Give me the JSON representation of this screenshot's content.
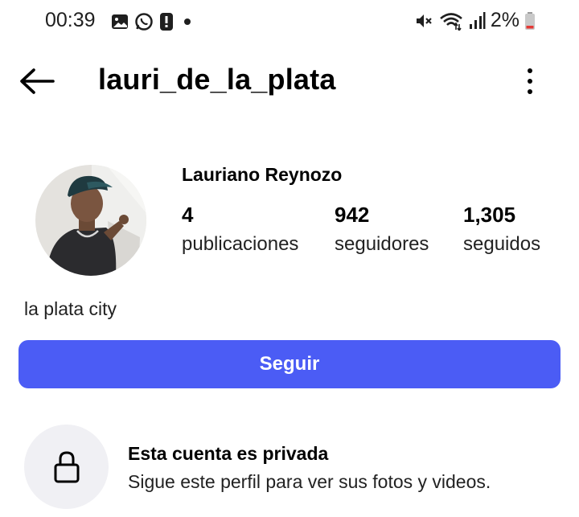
{
  "status_bar": {
    "time": "00:39",
    "battery_percent": "2%"
  },
  "header": {
    "username": "lauri_de_la_plata"
  },
  "profile": {
    "full_name": "Lauriano Reynozo",
    "stats": [
      {
        "value": "4",
        "label": "publicaciones"
      },
      {
        "value": "942",
        "label": "seguidores"
      },
      {
        "value": "1,305",
        "label": "seguidos"
      }
    ],
    "bio": "la plata city"
  },
  "actions": {
    "follow_label": "Seguir"
  },
  "private_notice": {
    "title": "Esta cuenta es privada",
    "subtitle": "Sigue este perfil para ver sus fotos y videos."
  },
  "colors": {
    "follow_button": "#4b5cf5",
    "lock_background": "#f0f0f4"
  },
  "icons": [
    "image-icon",
    "whatsapp-icon",
    "alert-icon",
    "dot-icon",
    "mute-icon",
    "wifi-icon",
    "signal-icon",
    "battery-icon",
    "back-arrow-icon",
    "more-vert-icon",
    "lock-icon"
  ]
}
